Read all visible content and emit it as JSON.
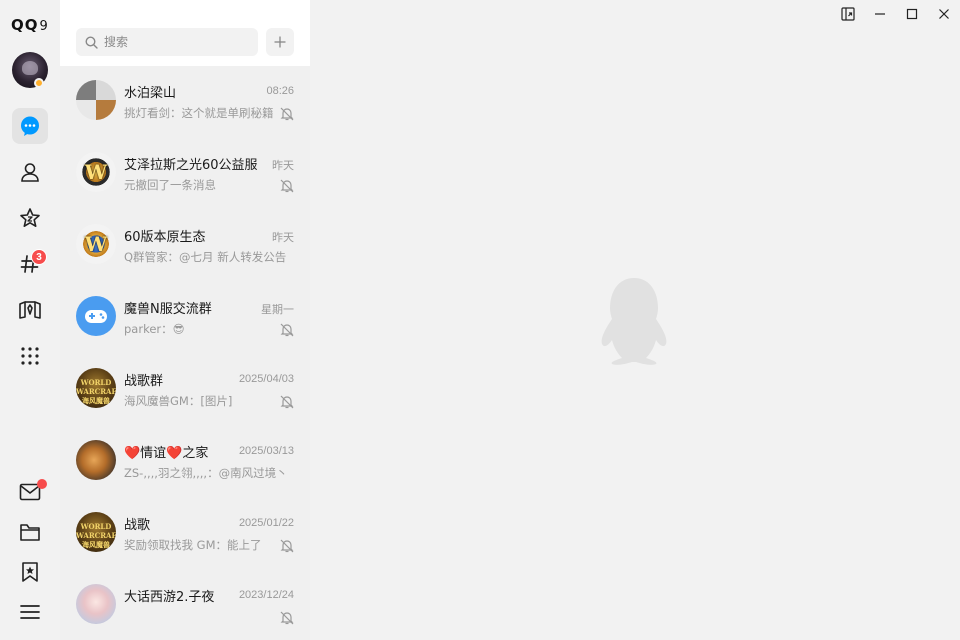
{
  "app": {
    "logo_text": "QQ",
    "logo_version": "9"
  },
  "rail": {
    "items": [
      {
        "name": "messages",
        "active": true
      },
      {
        "name": "contacts"
      },
      {
        "name": "favorites-star"
      },
      {
        "name": "channels",
        "badge": "3"
      },
      {
        "name": "games"
      },
      {
        "name": "apps-grid"
      }
    ],
    "bottom": [
      {
        "name": "mail",
        "dot": true
      },
      {
        "name": "files"
      },
      {
        "name": "bookmarks"
      },
      {
        "name": "menu"
      }
    ]
  },
  "search": {
    "placeholder": "搜索"
  },
  "conversations": [
    {
      "name": "水泊梁山",
      "time": "08:26",
      "preview": "挑灯看剑：这个就是单刷秘籍",
      "muted": true
    },
    {
      "name": "艾泽拉斯之光60公益服",
      "time": "昨天",
      "preview": "元撤回了一条消息",
      "muted": true
    },
    {
      "name": "60版本原生态",
      "time": "昨天",
      "preview": "Q群管家：@七月 新人转发公告",
      "muted": false
    },
    {
      "name": "魔兽N服交流群",
      "time": "星期一",
      "preview": "parker：😎",
      "muted": true
    },
    {
      "name": "战歌群",
      "time": "2025/04/03",
      "preview": "海风魔兽GM：[图片]",
      "muted": true
    },
    {
      "name": "❤️情谊❤️之家",
      "time": "2025/03/13",
      "preview": "ZS-,,,,羽之翎,,,,：@南风过境丶",
      "muted": false
    },
    {
      "name": "战歌",
      "time": "2025/01/22",
      "preview": "奖励领取找我 GM：能上了",
      "muted": true
    },
    {
      "name": "大话西游2.子夜",
      "time": "2023/12/24",
      "preview": "",
      "muted": true
    }
  ],
  "avatar_labels": {
    "wow_letter": "W",
    "warcraft_line1": "WORLD",
    "warcraft_line2": "WARCRAFT",
    "warcraft_line3": "海风魔兽"
  },
  "colors": {
    "accent": "#0099ff",
    "badge": "#f74c4c",
    "list_bg": "#f0f0f0",
    "main_bg": "#f2f2f2"
  }
}
